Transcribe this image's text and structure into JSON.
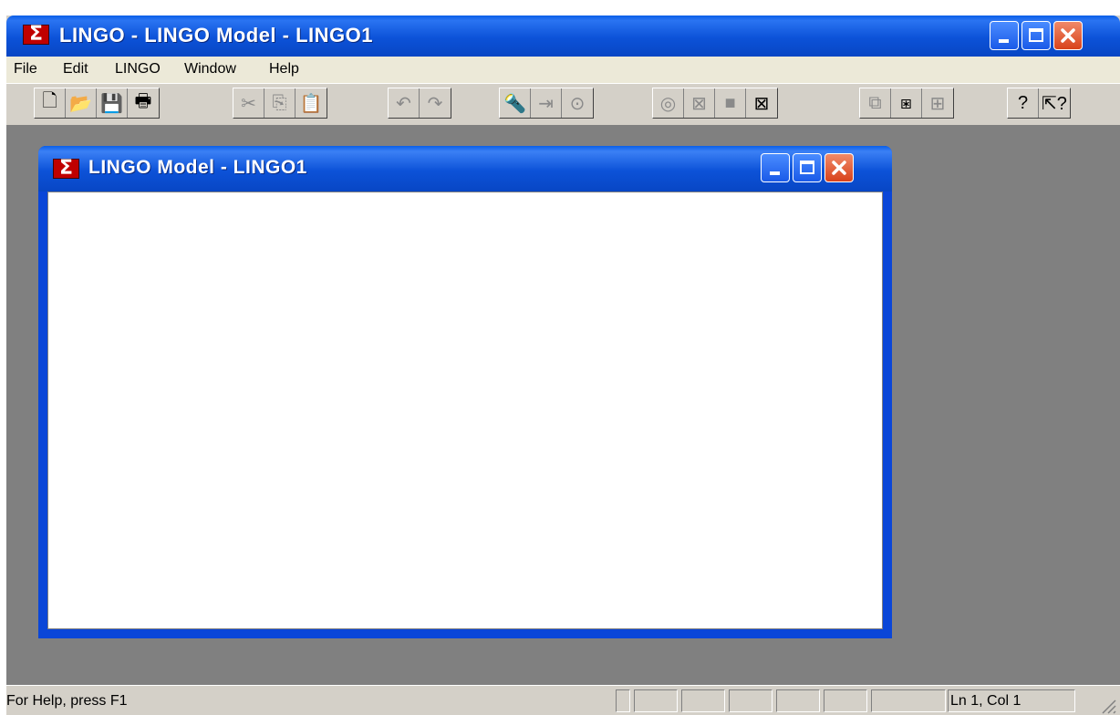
{
  "app": {
    "title": "LINGO - LINGO Model - LINGO1",
    "icon": "lingo-sigma-icon",
    "icon_glyph": "Σ"
  },
  "menu": [
    "File",
    "Edit",
    "LINGO",
    "Window",
    "Help"
  ],
  "toolbar": {
    "groups": [
      [
        {
          "icon": "new-file-icon",
          "glyph": "🗋",
          "enabled": true
        },
        {
          "icon": "open-folder-icon",
          "glyph": "📂",
          "enabled": true
        },
        {
          "icon": "save-disk-icon",
          "glyph": "💾",
          "enabled": true
        },
        {
          "icon": "print-icon",
          "glyph": "🖶",
          "enabled": true
        }
      ],
      [
        {
          "icon": "cut-icon",
          "glyph": "✂",
          "enabled": false
        },
        {
          "icon": "copy-icon",
          "glyph": "⎘",
          "enabled": false
        },
        {
          "icon": "paste-icon",
          "glyph": "📋",
          "enabled": true
        }
      ],
      [
        {
          "icon": "undo-icon",
          "glyph": "↶",
          "enabled": false
        },
        {
          "icon": "redo-icon",
          "glyph": "↷",
          "enabled": false
        }
      ],
      [
        {
          "icon": "find-icon",
          "glyph": "🔦",
          "enabled": false
        },
        {
          "icon": "goto-line-icon",
          "glyph": "⇥",
          "enabled": false
        },
        {
          "icon": "match-parenthesis-icon",
          "glyph": "⊙",
          "enabled": false
        }
      ],
      [
        {
          "icon": "solve-target-icon",
          "glyph": "◎",
          "enabled": false
        },
        {
          "icon": "solution-report-icon",
          "glyph": "⊠",
          "enabled": false
        },
        {
          "icon": "matrix-picture-icon",
          "glyph": "■",
          "enabled": false
        },
        {
          "icon": "options-icon",
          "glyph": "⊠",
          "enabled": true
        }
      ],
      [
        {
          "icon": "send-to-back-icon",
          "glyph": "⧉",
          "enabled": false
        },
        {
          "icon": "close-all-icon",
          "glyph": "⧆",
          "enabled": true
        },
        {
          "icon": "tile-icon",
          "glyph": "⊞",
          "enabled": false
        }
      ],
      [
        {
          "icon": "help-topics-icon",
          "glyph": "?",
          "enabled": true
        },
        {
          "icon": "context-help-icon",
          "glyph": "⇱?",
          "enabled": true
        }
      ]
    ]
  },
  "child_window": {
    "title": "LINGO Model - LINGO1",
    "content": ""
  },
  "status": {
    "help_text": "For Help, press F1",
    "position": "Ln 1, Col 1"
  },
  "colors": {
    "titlebar": "#0a5fe8",
    "mdi_background": "#808080",
    "face": "#d4d0c8",
    "close_button": "#d8421a"
  }
}
